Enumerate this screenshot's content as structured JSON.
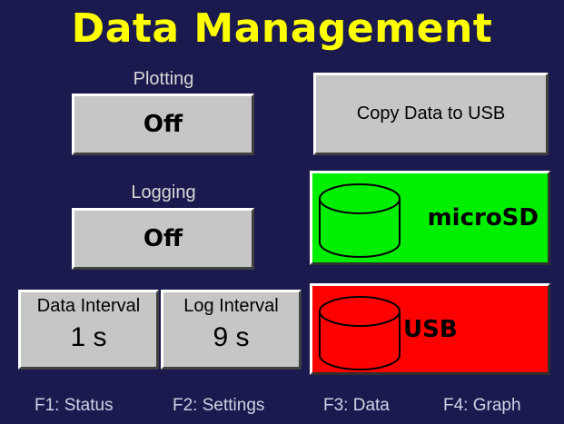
{
  "title": "Data Management",
  "plotting": {
    "label": "Plotting",
    "value": "Off"
  },
  "logging": {
    "label": "Logging",
    "value": "Off"
  },
  "data_interval": {
    "label": "Data Interval",
    "value": "1 s"
  },
  "log_interval": {
    "label": "Log Interval",
    "value": "9 s"
  },
  "copy_button": {
    "label": "Copy Data to USB"
  },
  "microsd": {
    "label": "microSD",
    "color": "#00ee00",
    "icon": "storage-cylinder-icon"
  },
  "usb": {
    "label": "USB",
    "color": "#ff0000",
    "icon": "storage-cylinder-icon"
  },
  "function_keys": [
    {
      "label": "F1: Status"
    },
    {
      "label": "F2: Settings"
    },
    {
      "label": "F3: Data"
    },
    {
      "label": "F4: Graph"
    }
  ],
  "colors": {
    "background": "#1a1a4e",
    "title": "#ffff00",
    "button": "#c6c6c6"
  }
}
